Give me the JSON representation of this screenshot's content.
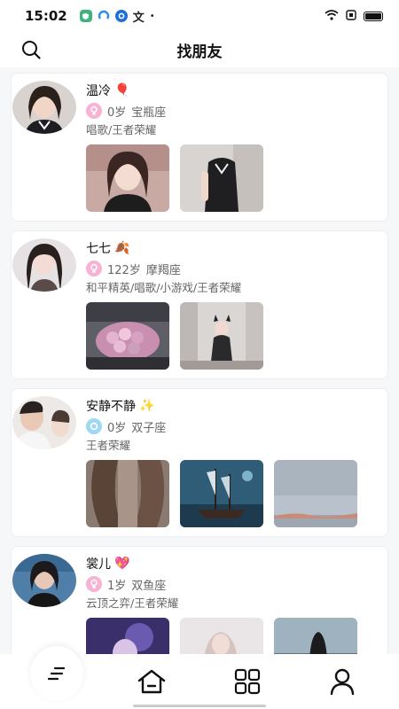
{
  "status_bar": {
    "time": "15:02",
    "apps": [
      {
        "icon": "shield-app-icon",
        "color": "#3fb37f"
      },
      {
        "icon": "arc-app-icon",
        "color": "#2d8cf0"
      },
      {
        "icon": "ring-app-icon",
        "color": "#1e6fd9"
      },
      {
        "icon": "text-app-icon",
        "color": "#222222"
      }
    ],
    "app_text": "文",
    "dot": "•"
  },
  "header": {
    "title": "找朋友",
    "search_icon": "search-icon"
  },
  "users": [
    {
      "name": "温冷",
      "name_emoji": "🎈",
      "gender": "female",
      "age": "0岁",
      "zodiac": "宝瓶座",
      "tags": "唱歌/王者荣耀",
      "photos": 2
    },
    {
      "name": "七七",
      "name_emoji": "🍂",
      "gender": "female",
      "age": "122岁",
      "zodiac": "摩羯座",
      "tags": "和平精英/唱歌/小游戏/王者荣耀",
      "photos": 2
    },
    {
      "name": "安静不静",
      "name_emoji": "✨",
      "gender": "male",
      "age": "0岁",
      "zodiac": "双子座",
      "tags": "王者荣耀",
      "photos": 3
    },
    {
      "name": "裳儿",
      "name_emoji": "💖",
      "gender": "female",
      "age": "1岁",
      "zodiac": "双鱼座",
      "tags": "云顶之弈/王者荣耀",
      "photos": 3
    }
  ],
  "bottom_nav": [
    {
      "icon": "feed-sort-icon",
      "active": true
    },
    {
      "icon": "home-icon",
      "active": false
    },
    {
      "icon": "grid-icon",
      "active": false
    },
    {
      "icon": "profile-icon",
      "active": false
    }
  ],
  "colors": {
    "female_bg": "#f7b2d4",
    "male_bg": "#9fd8f3",
    "text_secondary": "#666666"
  }
}
